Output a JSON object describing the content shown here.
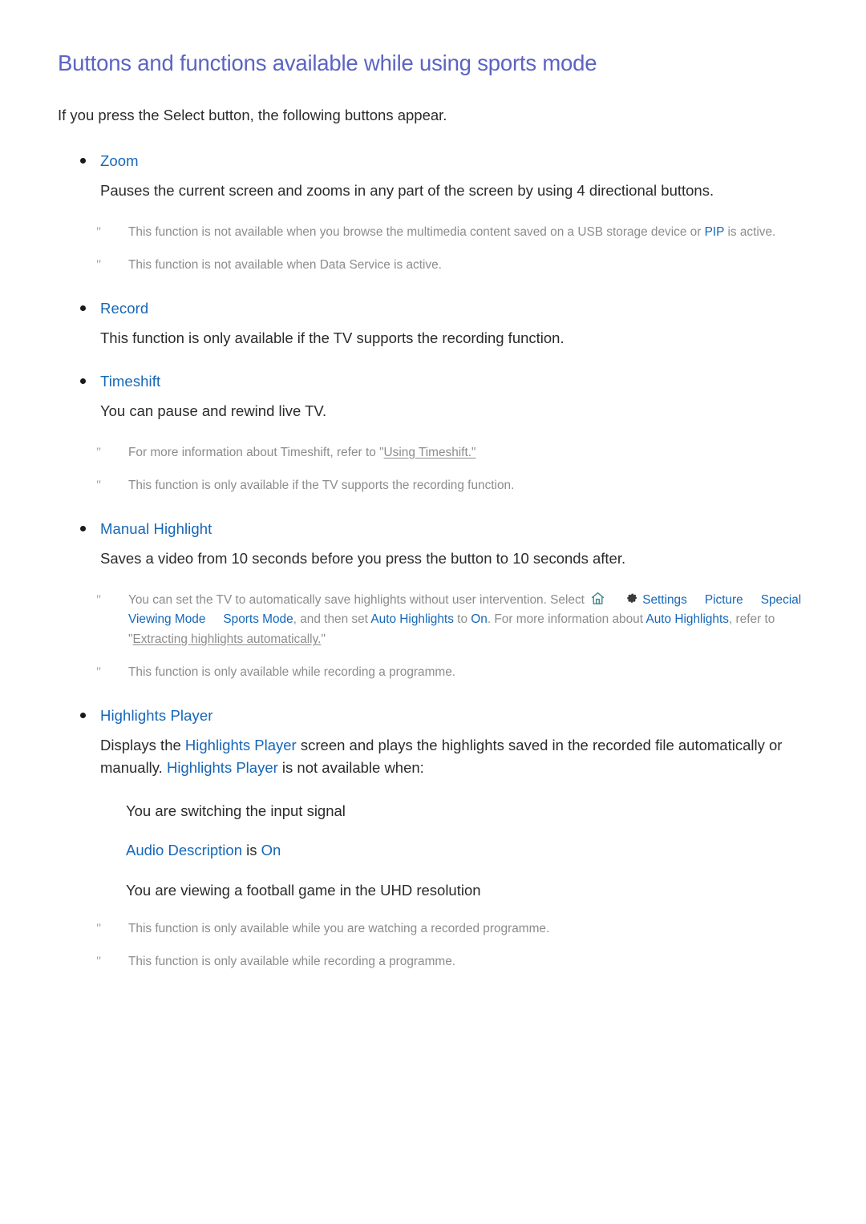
{
  "document": {
    "title": "Buttons and functions available while using sports mode",
    "intro": "If you press the Select button, the following buttons appear.",
    "note_marker": "\""
  },
  "colors": {
    "title": "#5b63c4",
    "link": "#1667b8",
    "body": "#2b2b2b",
    "note": "#8c8c8c",
    "home_icon": "#3f8a8f",
    "gear_icon": "#3a3a3a"
  },
  "sections": [
    {
      "id": "zoom",
      "label": "Zoom",
      "description": "Pauses the current screen and zooms in any part of the screen by using 4 directional buttons.",
      "notes": [
        {
          "parts": [
            {
              "type": "text",
              "value": "This function is not available when you browse the multimedia content saved on a USB storage device or "
            },
            {
              "type": "link",
              "value": "PIP"
            },
            {
              "type": "text",
              "value": " is active."
            }
          ]
        },
        {
          "parts": [
            {
              "type": "text",
              "value": "This function is not available when Data Service is active."
            }
          ]
        }
      ]
    },
    {
      "id": "record",
      "label": "Record",
      "description": "This function is only available if the TV supports the recording function.",
      "notes": []
    },
    {
      "id": "timeshift",
      "label": "Timeshift",
      "description": "You can pause and rewind live TV.",
      "notes": [
        {
          "parts": [
            {
              "type": "text",
              "value": "For more information about Timeshift, refer to \""
            },
            {
              "type": "underline",
              "value": "Using Timeshift.\""
            }
          ]
        },
        {
          "parts": [
            {
              "type": "text",
              "value": "This function is only available if the TV supports the recording function."
            }
          ]
        }
      ]
    },
    {
      "id": "manual-highlight",
      "label": "Manual Highlight",
      "description": "Saves a video from 10 seconds before you press the button to 10 seconds after.",
      "notes": [
        {
          "parts": [
            {
              "type": "text",
              "value": "You can set the TV to automatically save highlights without user intervention. Select "
            },
            {
              "type": "icon",
              "value": "home-icon"
            },
            {
              "type": "gap",
              "value": ""
            },
            {
              "type": "icon",
              "value": "gear-icon"
            },
            {
              "type": "link",
              "value": "Settings"
            },
            {
              "type": "gap",
              "value": ""
            },
            {
              "type": "link",
              "value": "Picture"
            },
            {
              "type": "gap",
              "value": ""
            },
            {
              "type": "link",
              "value": "Special Viewing Mode"
            },
            {
              "type": "gap",
              "value": ""
            },
            {
              "type": "link",
              "value": "Sports Mode"
            },
            {
              "type": "text",
              "value": ", and then set "
            },
            {
              "type": "link",
              "value": "Auto Highlights"
            },
            {
              "type": "text",
              "value": " to "
            },
            {
              "type": "link",
              "value": "On"
            },
            {
              "type": "text",
              "value": ". For more information about "
            },
            {
              "type": "link",
              "value": "Auto Highlights"
            },
            {
              "type": "text",
              "value": ", refer to \""
            },
            {
              "type": "underline",
              "value": "Extracting highlights automatically."
            },
            {
              "type": "text",
              "value": "\""
            }
          ]
        },
        {
          "parts": [
            {
              "type": "text",
              "value": "This function is only available while recording a programme."
            }
          ]
        }
      ]
    },
    {
      "id": "highlights-player",
      "label": "Highlights Player",
      "description_parts": [
        {
          "type": "text",
          "value": "Displays the "
        },
        {
          "type": "link",
          "value": "Highlights Player"
        },
        {
          "type": "text",
          "value": " screen and plays the highlights saved in the recorded file automatically or manually. "
        },
        {
          "type": "link",
          "value": "Highlights Player"
        },
        {
          "type": "text",
          "value": " is not available when:"
        }
      ],
      "subitems": [
        {
          "parts": [
            {
              "type": "text",
              "value": "You are switching the input signal"
            }
          ]
        },
        {
          "parts": [
            {
              "type": "link",
              "value": "Audio Description"
            },
            {
              "type": "text",
              "value": " is "
            },
            {
              "type": "link",
              "value": "On"
            }
          ]
        },
        {
          "parts": [
            {
              "type": "text",
              "value": "You are viewing a football game in the UHD resolution"
            }
          ]
        }
      ],
      "notes": [
        {
          "parts": [
            {
              "type": "text",
              "value": "This function is only available while you are watching a recorded programme."
            }
          ]
        },
        {
          "parts": [
            {
              "type": "text",
              "value": "This function is only available while recording a programme."
            }
          ]
        }
      ]
    }
  ]
}
